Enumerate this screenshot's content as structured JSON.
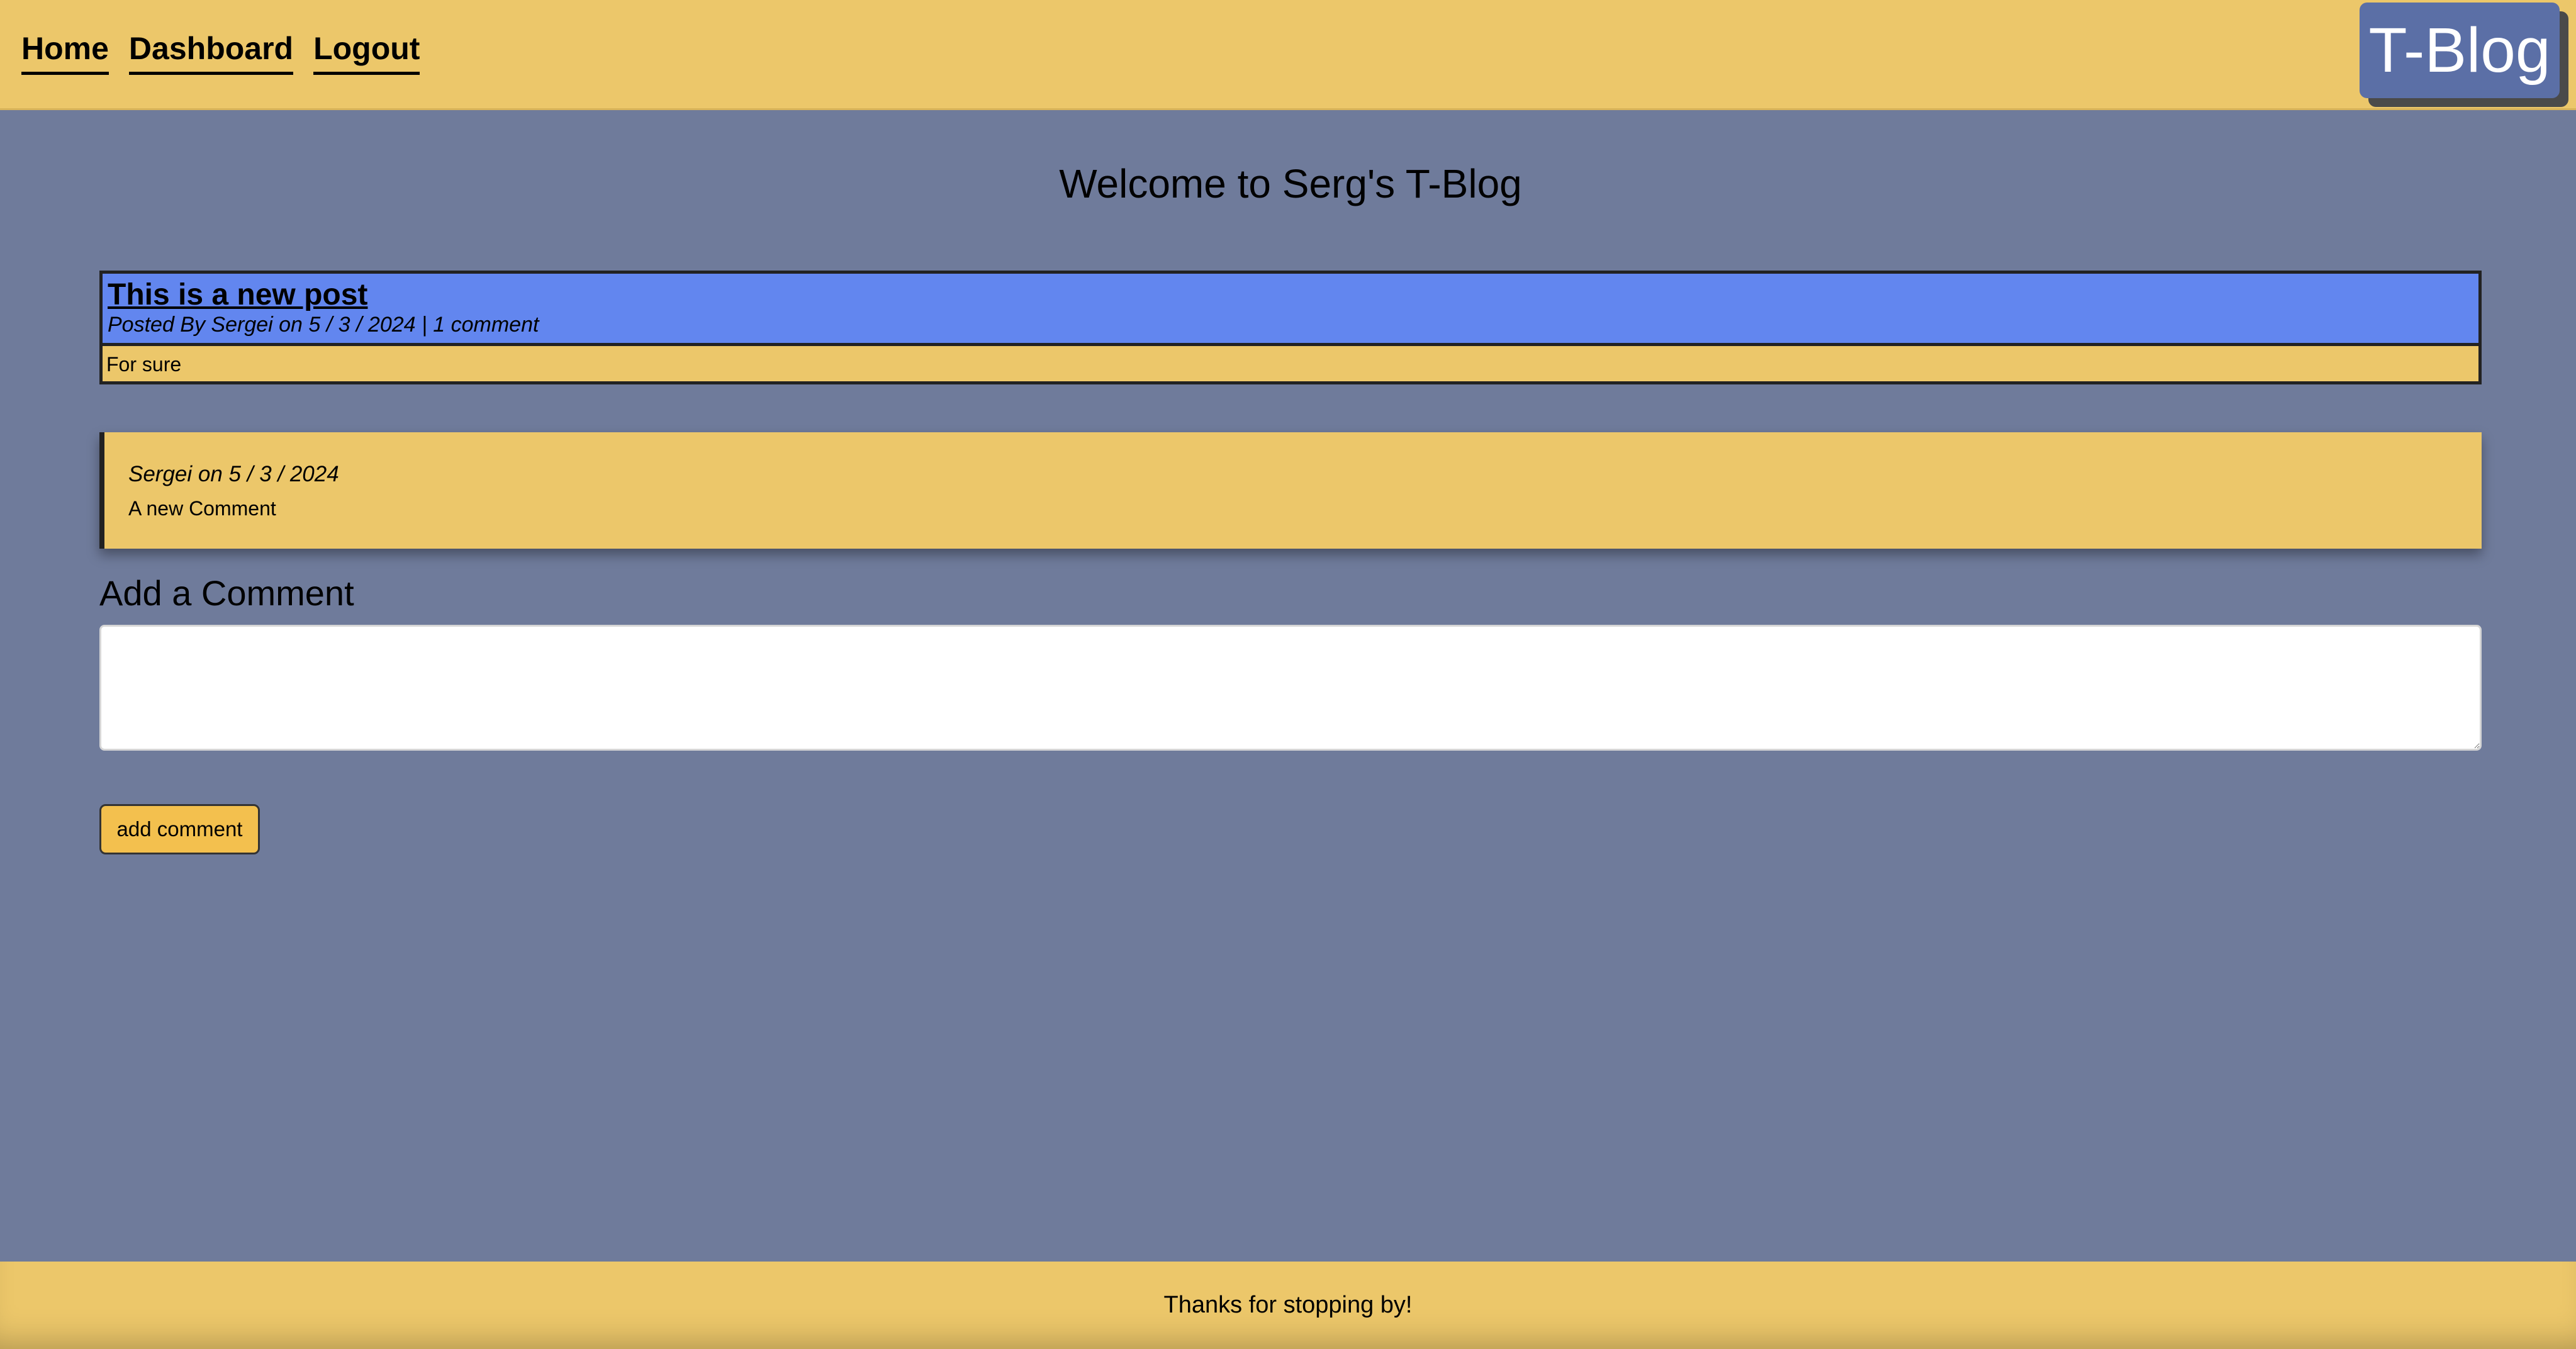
{
  "nav": {
    "home": "Home",
    "dashboard": "Dashboard",
    "logout": "Logout",
    "brand": "T-Blog"
  },
  "page": {
    "welcome": "Welcome to Serg's T-Blog"
  },
  "post": {
    "title": "This is a new post",
    "meta": "Posted By Sergei on 5 / 3 / 2024 | 1 comment",
    "body": "For sure"
  },
  "comments": [
    {
      "meta": "Sergei on 5 / 3 / 2024",
      "text": "A new Comment"
    }
  ],
  "add_comment": {
    "heading": "Add a Comment",
    "textarea_value": "",
    "button_label": "add comment"
  },
  "footer": {
    "text": "Thanks for stopping by!"
  },
  "colors": {
    "background": "#6f7b9b",
    "header_footer": "#ecc76a",
    "post_header": "#6286ef",
    "brand_box": "#5b6fa6",
    "button": "#f3c04e"
  }
}
